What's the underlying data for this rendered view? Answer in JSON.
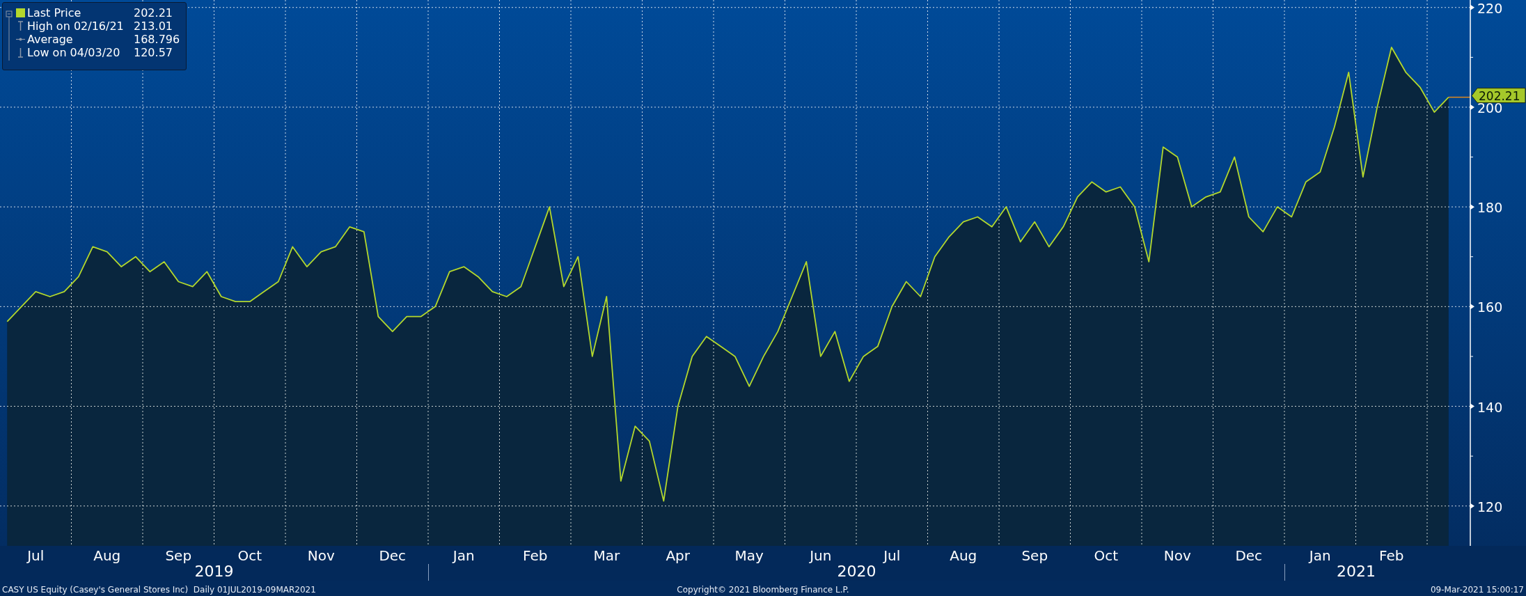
{
  "legend": {
    "entries": [
      {
        "kind": "swatch",
        "value": "202.21"
      },
      {
        "kind": "high",
        "label": "High on 02/16/21",
        "value": "213.01"
      },
      {
        "kind": "average",
        "label": "Average",
        "value": "168.796"
      },
      {
        "kind": "low",
        "label": "Low on 04/03/20",
        "value": "120.57"
      }
    ]
  },
  "chart": {
    "chart_data": {
      "type": "area",
      "grid": true,
      "series": [
        {
          "name": "Last Price",
          "color": "#b4d82c",
          "values": [
            157,
            160,
            163,
            162,
            163,
            166,
            172,
            171,
            168,
            170,
            167,
            169,
            165,
            164,
            167,
            162,
            161,
            161,
            163,
            165,
            172,
            168,
            171,
            172,
            176,
            175,
            158,
            155,
            158,
            158,
            160,
            167,
            168,
            166,
            163,
            162,
            164,
            172,
            180,
            164,
            170,
            150,
            162,
            125,
            136,
            133,
            121,
            140,
            150,
            154,
            152,
            150,
            144,
            150,
            155,
            162,
            169,
            150,
            155,
            145,
            150,
            152,
            160,
            165,
            162,
            170,
            174,
            177,
            178,
            176,
            180,
            173,
            177,
            172,
            176,
            182,
            185,
            183,
            184,
            180,
            169,
            192,
            190,
            180,
            182,
            183,
            190,
            178,
            175,
            180,
            178,
            185,
            187,
            196,
            207,
            186,
            200,
            212,
            207,
            204,
            199,
            202
          ]
        }
      ],
      "ylim": [
        112,
        221.5
      ],
      "yticks": [
        120,
        140,
        160,
        180,
        200,
        220
      ]
    },
    "months": [
      "Jul",
      "Aug",
      "Sep",
      "Oct",
      "Nov",
      "Dec",
      "Jan",
      "Feb",
      "Mar",
      "Apr",
      "May",
      "Jun",
      "Jul",
      "Aug",
      "Sep",
      "Oct",
      "Nov",
      "Dec",
      "Jan",
      "Feb"
    ],
    "last_price_tag": "202.21",
    "years": [
      "2019",
      "2020",
      "2021"
    ]
  },
  "footer": {
    "security": "CASY US Equity (Casey's General Stores Inc)  Daily 01JUL2019-09MAR2021",
    "copyright": "Copyright© 2021 Bloomberg Finance L.P.",
    "timestamp": "09-Mar-2021 15:00:17"
  }
}
